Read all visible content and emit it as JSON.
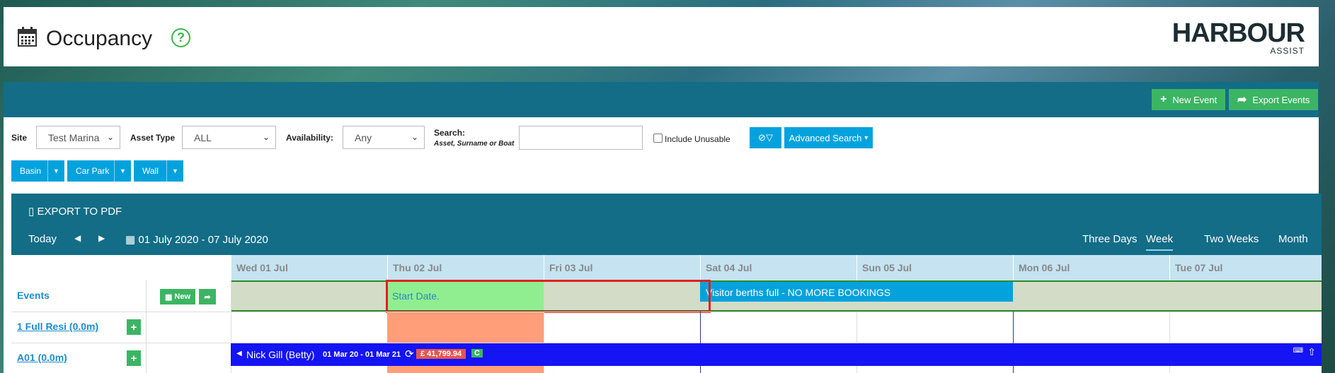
{
  "header": {
    "title": "Occupancy",
    "help_glyph": "?",
    "logo_main": "HARBOUR",
    "logo_sub": "ASSIST"
  },
  "toolbar": {
    "new_event": "New Event",
    "export_events": "Export Events"
  },
  "filters": {
    "site_label": "Site",
    "site_value": "Test Marina",
    "asset_type_label": "Asset Type",
    "asset_type_value": "ALL",
    "availability_label": "Availability:",
    "availability_value": "Any",
    "search_label": "Search:",
    "search_hint": "Asset, Surname or Boat",
    "search_value": "",
    "include_unusable_label": "Include Unusable",
    "advanced_search": "Advanced Search"
  },
  "groups": [
    "Basin",
    "Car Park",
    "Wall"
  ],
  "calendar": {
    "export_pdf": "EXPORT TO PDF",
    "today": "Today",
    "range": "01 July 2020 - 07 July 2020",
    "views": [
      "Three Days",
      "Week",
      "Two Weeks",
      "Month"
    ],
    "active_view": "Week",
    "days": [
      "Wed 01 Jul",
      "Thu 02 Jul",
      "Fri 03 Jul",
      "Sat 04 Jul",
      "Sun 05 Jul",
      "Mon 06 Jul",
      "Tue 07 Jul"
    ]
  },
  "rows": {
    "events_label": "Events",
    "events_new": "New",
    "resi_label": "1 Full Resi (0.0m)",
    "a01_label": "A01 (0.0m)"
  },
  "events": {
    "start_date": "Start Date.",
    "visitor_full": "Visitor berths full - NO MORE BOOKINGS"
  },
  "booking": {
    "name": "Nick Gill (Betty)",
    "dates": "01 Mar 20 - 01 Mar 21",
    "amount": "£ 41,799.94",
    "status": "C"
  },
  "colors": {
    "primary_dark": "#136d87",
    "accent_blue": "#03a2dd",
    "green": "#3cb563",
    "highlight_red": "#e02020",
    "booking_blue": "#1414f5"
  }
}
